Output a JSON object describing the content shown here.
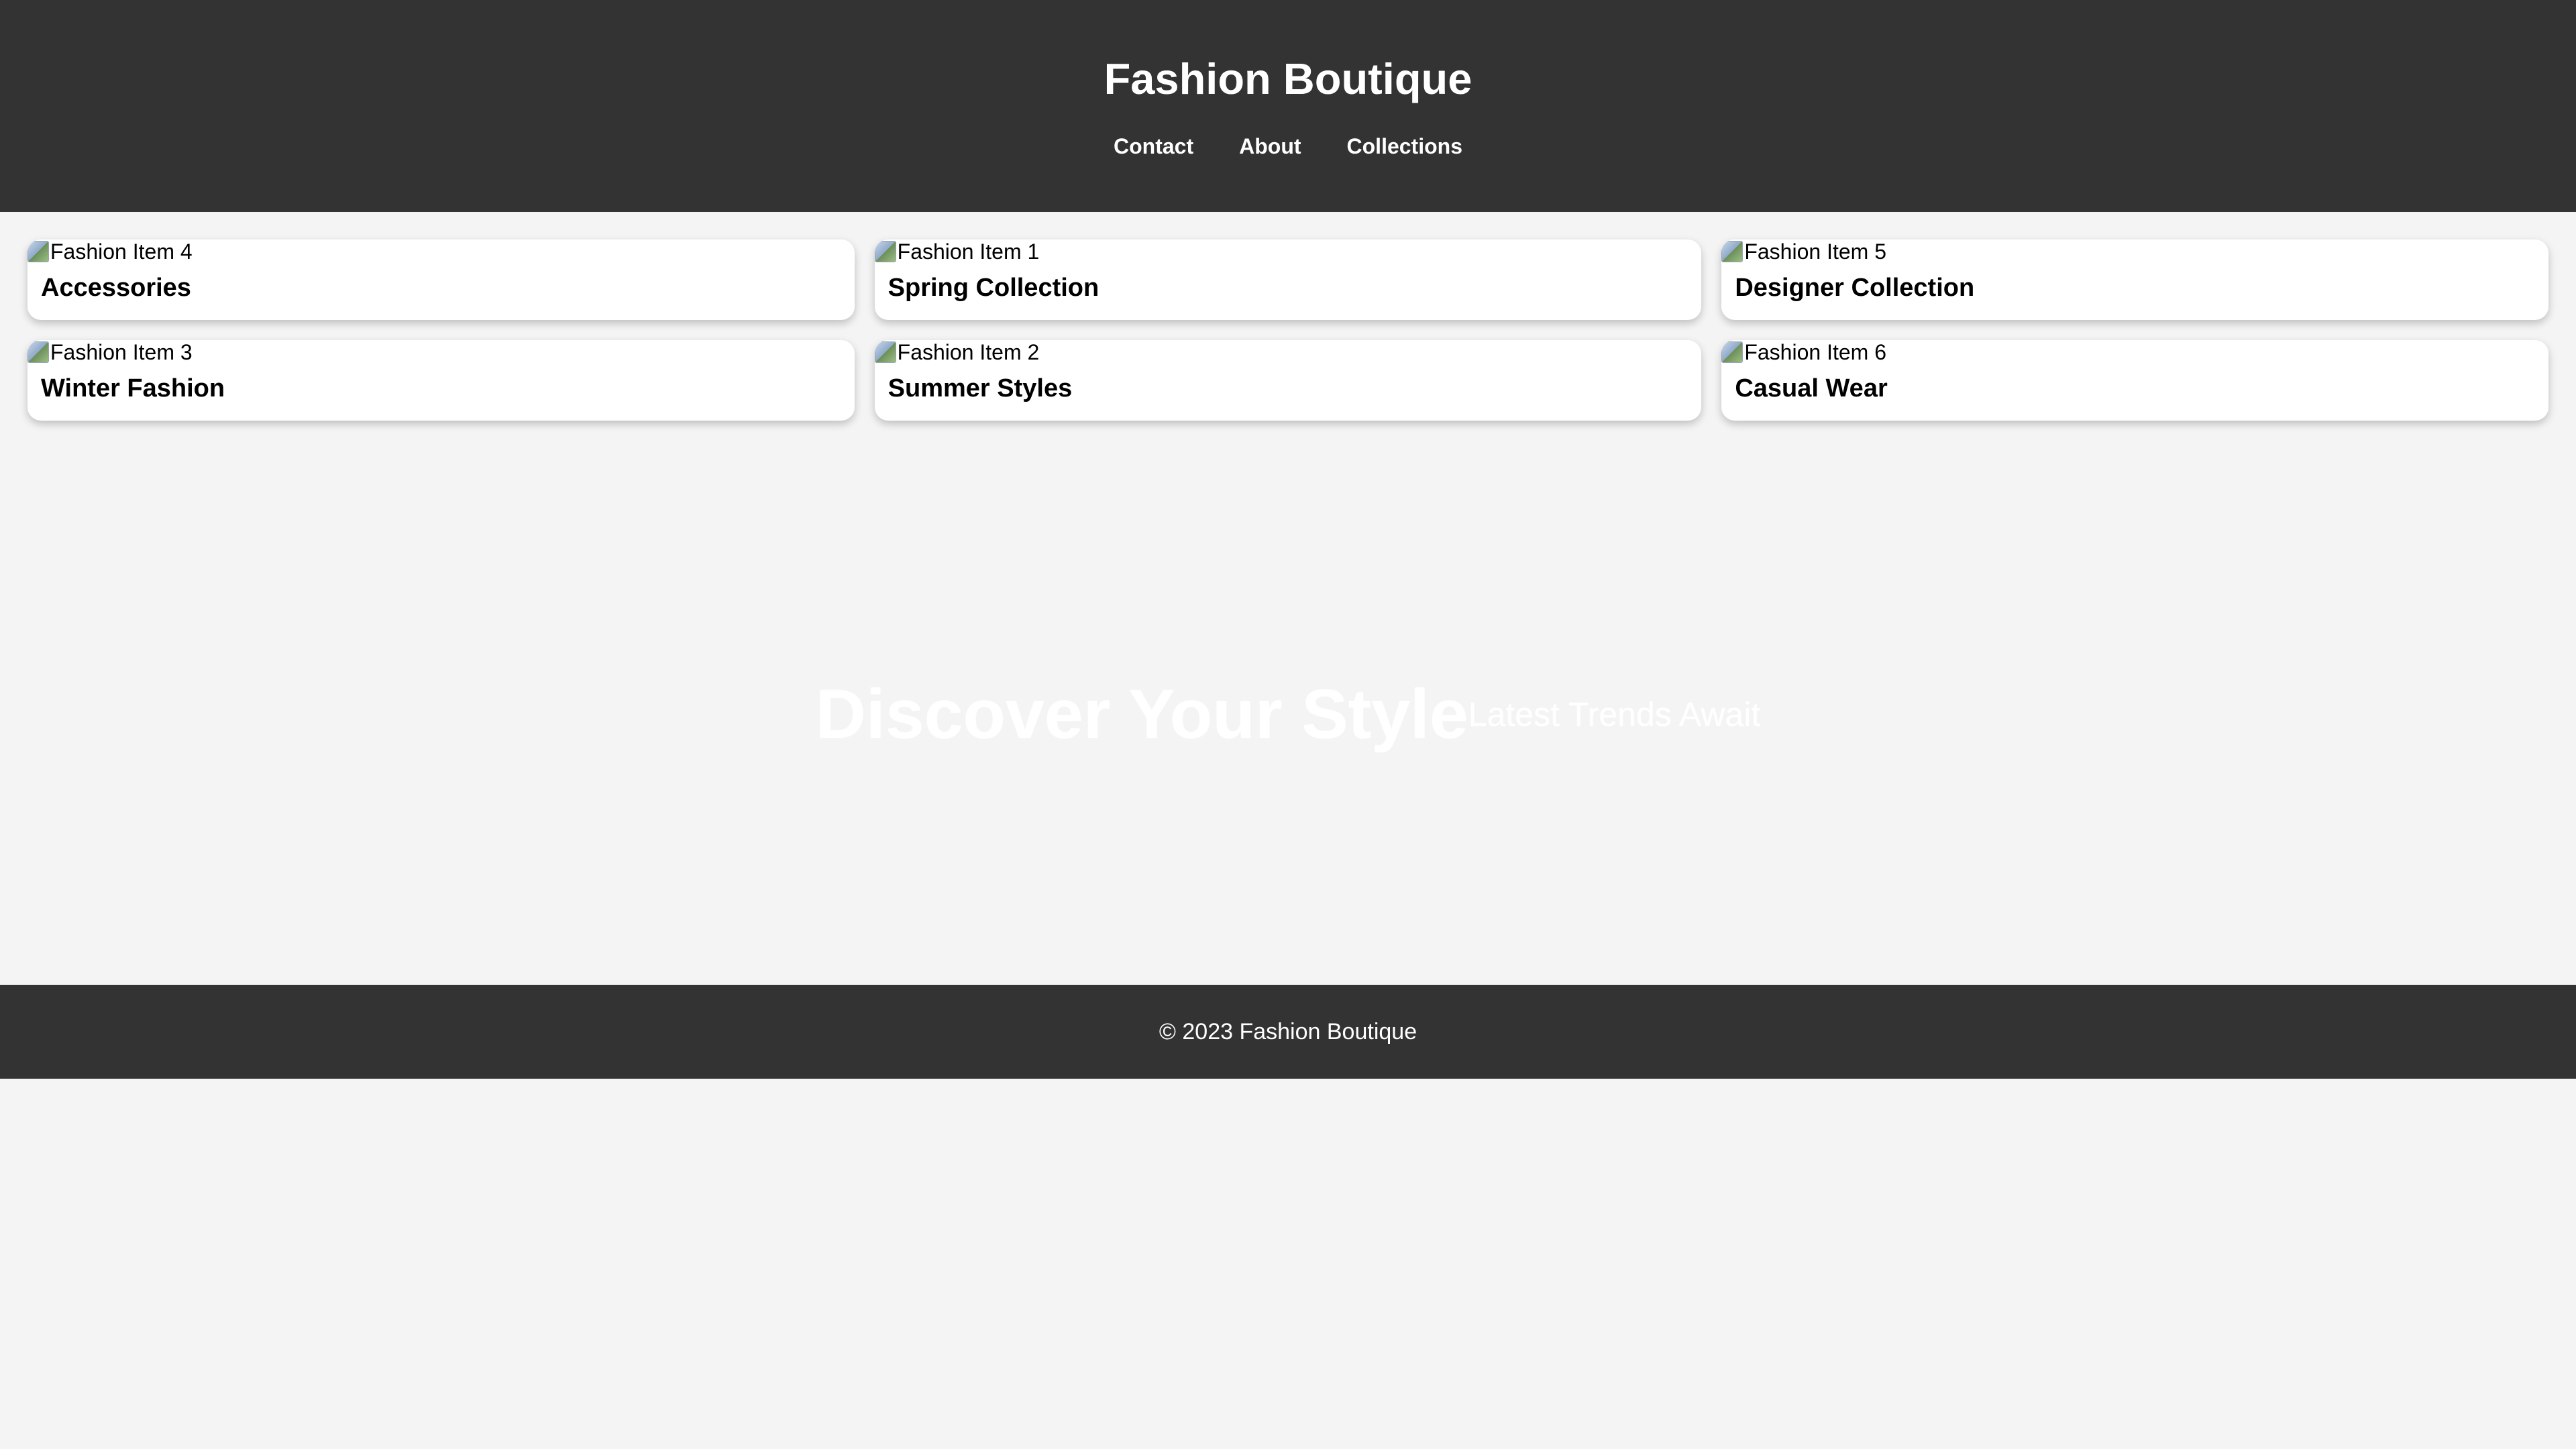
{
  "header": {
    "title": "Fashion Boutique",
    "nav": [
      {
        "label": "Contact"
      },
      {
        "label": "About"
      },
      {
        "label": "Collections"
      }
    ]
  },
  "cards": [
    {
      "image_alt": "Fashion Item 4",
      "title": "Accessories"
    },
    {
      "image_alt": "Fashion Item 1",
      "title": "Spring Collection"
    },
    {
      "image_alt": "Fashion Item 5",
      "title": "Designer Collection"
    },
    {
      "image_alt": "Fashion Item 3",
      "title": "Winter Fashion"
    },
    {
      "image_alt": "Fashion Item 2",
      "title": "Summer Styles"
    },
    {
      "image_alt": "Fashion Item 6",
      "title": "Casual Wear"
    }
  ],
  "hero": {
    "title": "Discover Your Style",
    "subtitle": "Latest Trends Await"
  },
  "footer": {
    "text": "© 2023 Fashion Boutique"
  },
  "colors": {
    "header_bg": "#333333",
    "page_bg": "#f4f4f4",
    "card_bg": "#ffffff",
    "text_light": "#ffffff"
  },
  "icons": {
    "card_image": "broken-image-icon"
  }
}
